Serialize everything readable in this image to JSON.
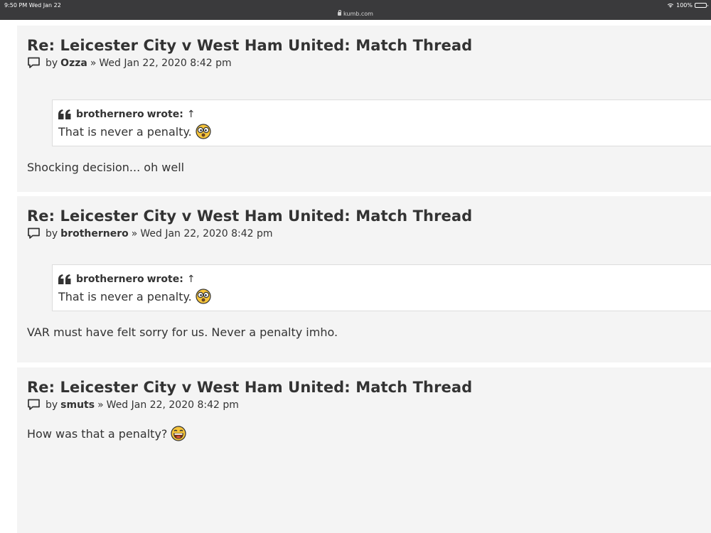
{
  "status_bar": {
    "time": "9:50 PM   Wed Jan 22",
    "url": "kumb.com",
    "battery": "100%"
  },
  "posts": [
    {
      "title": "Re: Leicester City v West Ham United: Match Thread",
      "by": "by",
      "author": "Ozza",
      "sep": "»",
      "date": "Wed Jan 22, 2020 8:42 pm",
      "quote": {
        "author": "brothernero",
        "wrote": "wrote:",
        "arrow": "↑",
        "text": "That is never a penalty."
      },
      "body": "Shocking decision... oh well"
    },
    {
      "title": "Re: Leicester City v West Ham United: Match Thread",
      "by": "by",
      "author": "brothernero",
      "sep": "»",
      "date": "Wed Jan 22, 2020 8:42 pm",
      "quote": {
        "author": "brothernero",
        "wrote": "wrote:",
        "arrow": "↑",
        "text": "That is never a penalty."
      },
      "body": "VAR must have felt sorry for us. Never a penalty imho."
    },
    {
      "title": "Re: Leicester City v West Ham United: Match Thread",
      "by": "by",
      "author": "smuts",
      "sep": "»",
      "date": "Wed Jan 22, 2020 8:42 pm",
      "body": "How was that a penalty?"
    }
  ],
  "icons": {
    "post": "speech-bubble-icon",
    "quote": "quote-mark-icon",
    "emoji_quote": "shocked-emoji",
    "emoji_laugh": "laughing-emoji"
  }
}
